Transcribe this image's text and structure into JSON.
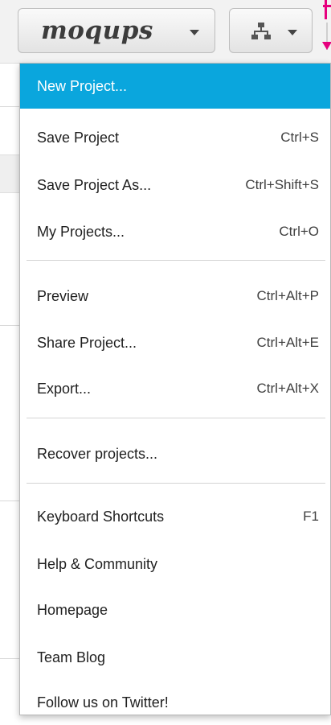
{
  "app": {
    "logo_text": "moqups"
  },
  "toolbar": {
    "logo_button_icon": "chevron-down-icon",
    "sitemap_icon": "sitemap-icon"
  },
  "menu": {
    "items": [
      {
        "label": "New Project...",
        "shortcut": ""
      },
      {
        "label": "Save Project",
        "shortcut": "Ctrl+S"
      },
      {
        "label": "Save Project As...",
        "shortcut": "Ctrl+Shift+S"
      },
      {
        "label": "My Projects...",
        "shortcut": "Ctrl+O"
      },
      {
        "label": "Preview",
        "shortcut": "Ctrl+Alt+P"
      },
      {
        "label": "Share Project...",
        "shortcut": "Ctrl+Alt+E"
      },
      {
        "label": "Export...",
        "shortcut": "Ctrl+Alt+X"
      },
      {
        "label": "Recover projects...",
        "shortcut": ""
      },
      {
        "label": "Keyboard Shortcuts",
        "shortcut": "F1"
      },
      {
        "label": "Help & Community",
        "shortcut": ""
      },
      {
        "label": "Homepage",
        "shortcut": ""
      },
      {
        "label": "Team Blog",
        "shortcut": ""
      },
      {
        "label": "Follow us on Twitter!",
        "shortcut": ""
      }
    ]
  },
  "colors": {
    "highlight": "#0aa6dd",
    "annotation": "#e6007e"
  }
}
